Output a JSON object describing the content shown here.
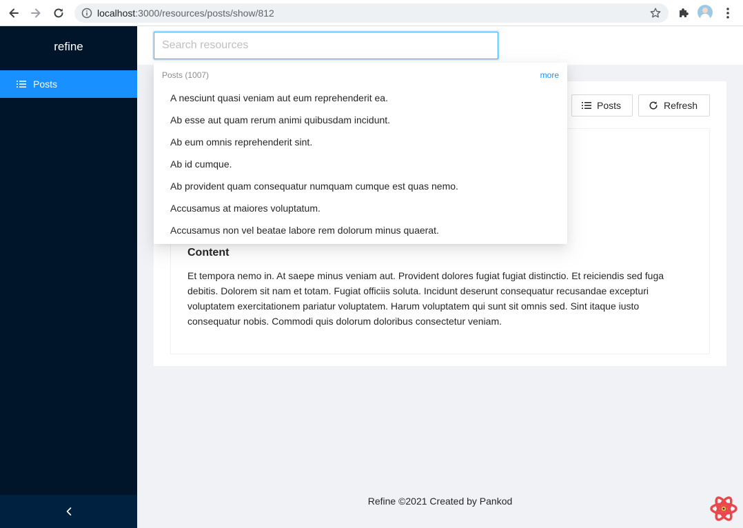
{
  "browser": {
    "url_host": "localhost",
    "url_path": ":3000/resources/posts/show/812"
  },
  "sidebar": {
    "logo": "refine",
    "items": [
      {
        "label": "Posts",
        "icon": "unordered-list-icon",
        "active": true
      }
    ],
    "collapse_icon": "chevron-left-icon"
  },
  "search": {
    "placeholder": "Search resources",
    "value": "",
    "group_label": "Posts (1007)",
    "more_label": "more",
    "results": [
      "A nesciunt quasi veniam aut eum reprehenderit ea.",
      "Ab esse aut quam rerum animi quibusdam incidunt.",
      "Ab eum omnis reprehenderit sint.",
      "Ab id cumque.",
      "Ab provident quam consequatur numquam cumque est quas nemo.",
      "Accusamus at maiores voluptatum.",
      "Accusamus non vel beatae labore rem dolorum minus quaerat."
    ]
  },
  "page": {
    "list_button": "Posts",
    "refresh_button": "Refresh",
    "content_title": "Content",
    "content_text": "Et tempora nemo in. At saepe minus veniam aut. Provident dolores fugiat fugiat distinctio. Et reiciendis sed fuga debitis. Dolorem sit nam et totam. Fugiat officiis soluta. Incidunt deserunt consequatur recusandae excepturi voluptatem exercitationem pariatur voluptatem. Harum voluptatem qui sunt sit omnis sed. Sint itaque iusto consequatur nobis. Commodi quis dolorum doloribus consectetur veniam."
  },
  "footer": {
    "text": "Refine ©2021 Created by Pankod"
  },
  "colors": {
    "sider": "#001529",
    "primary": "#1890ff",
    "background": "#f0f2f5"
  }
}
